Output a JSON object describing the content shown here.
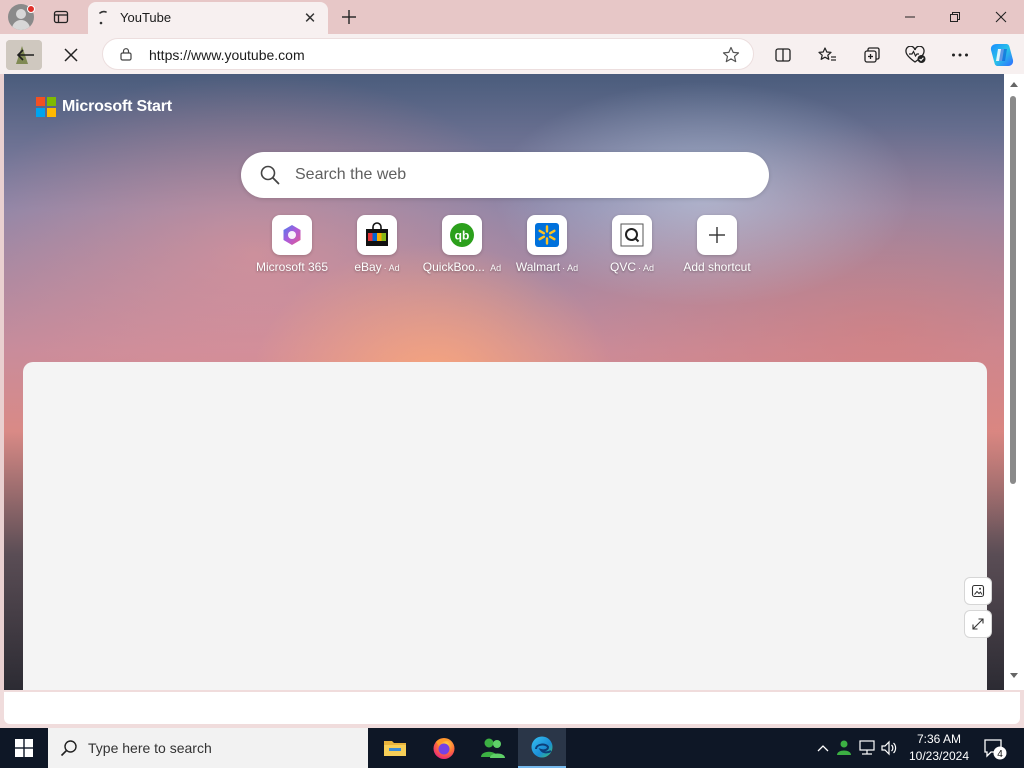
{
  "browser": {
    "tab": {
      "title": "YouTube"
    },
    "address_bar": {
      "url": "https://www.youtube.com"
    }
  },
  "newtab": {
    "brand": "Microsoft Start",
    "search": {
      "placeholder": "Search the web"
    },
    "shortcuts": [
      {
        "label": "Microsoft 365",
        "ad": ""
      },
      {
        "label": "eBay",
        "ad": "· Ad"
      },
      {
        "label": "QuickBoo...",
        "ad": "Ad"
      },
      {
        "label": "Walmart",
        "ad": "· Ad"
      },
      {
        "label": "QVC",
        "ad": "· Ad"
      },
      {
        "label": "Add shortcut",
        "ad": ""
      }
    ]
  },
  "taskbar": {
    "search_placeholder": "Type here to search",
    "time": "7:36 AM",
    "date": "10/23/2024",
    "notification_count": "4"
  },
  "colors": {
    "accent": "#0078d4",
    "titlebar": "#e7c7c7",
    "taskbar": "#0e1726"
  }
}
